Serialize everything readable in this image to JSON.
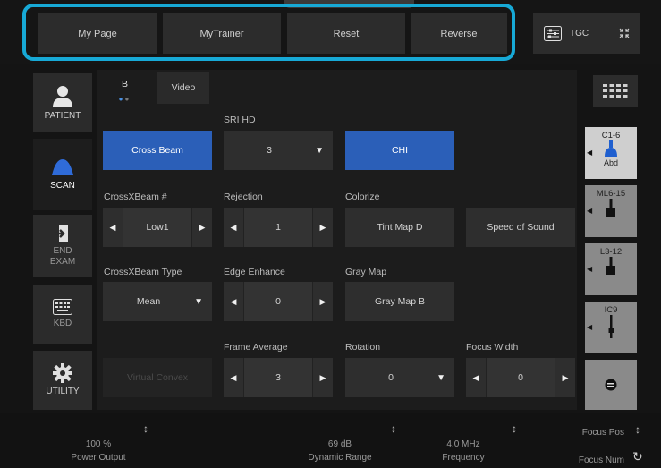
{
  "top": {
    "buttons": [
      "My Page",
      "MyTrainer",
      "Reset",
      "Reverse"
    ],
    "tgc_label": "TGC"
  },
  "sidebar": {
    "items": [
      {
        "label": "PATIENT",
        "icon": "person-icon"
      },
      {
        "label": "SCAN",
        "icon": "probe-icon"
      },
      {
        "label": "END\nEXAM",
        "icon": "exit-icon"
      },
      {
        "label": "KBD",
        "icon": "keyboard-icon"
      },
      {
        "label": "UTILITY",
        "icon": "gear-icon"
      }
    ]
  },
  "tabs": {
    "items": [
      "B",
      "Video"
    ]
  },
  "controls": {
    "sri_hd": {
      "label": "SRI HD",
      "value": "3"
    },
    "cross_beam": "Cross Beam",
    "chi": "CHI",
    "crossxbeam_num": {
      "label": "CrossXBeam #",
      "value": "Low1"
    },
    "rejection": {
      "label": "Rejection",
      "value": "1"
    },
    "colorize": {
      "label": "Colorize",
      "value": "Tint Map D"
    },
    "speed_of_sound": "Speed of Sound",
    "crossxbeam_type": {
      "label": "CrossXBeam Type",
      "value": "Mean"
    },
    "edge_enhance": {
      "label": "Edge Enhance",
      "value": "0"
    },
    "gray_map": {
      "label": "Gray Map",
      "value": "Gray Map B"
    },
    "frame_average": {
      "label": "Frame Average",
      "value": "3"
    },
    "rotation": {
      "label": "Rotation",
      "value": "0"
    },
    "focus_width": {
      "label": "Focus Width",
      "value": "0"
    },
    "virtual_convex": "Virtual Convex"
  },
  "probes": [
    {
      "name": "C1-6",
      "sub": "Abd"
    },
    {
      "name": "ML6-15",
      "sub": ""
    },
    {
      "name": "L3-12",
      "sub": ""
    },
    {
      "name": "IC9",
      "sub": ""
    }
  ],
  "bottom": {
    "power": {
      "value": "100 %",
      "label": "Power Output"
    },
    "dynamic": {
      "value": "69 dB",
      "label": "Dynamic Range"
    },
    "frequency": {
      "value": "4.0 MHz",
      "label": "Frequency"
    },
    "focus_pos": "Focus Pos",
    "focus_num": "Focus Num"
  },
  "colors": {
    "accent": "#17a9d6",
    "button_blue": "#2b5fb8"
  }
}
